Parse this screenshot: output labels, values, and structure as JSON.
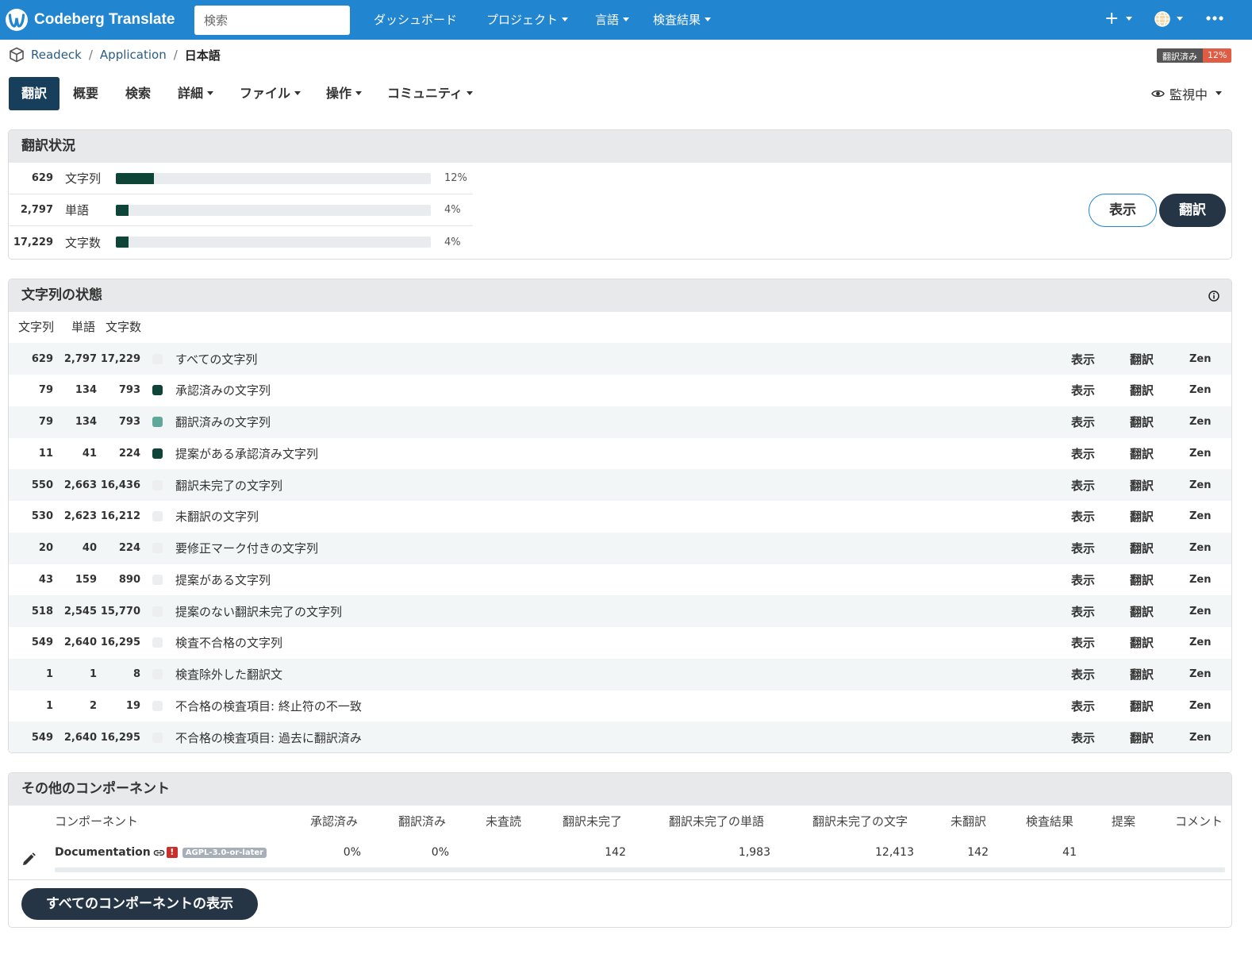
{
  "brand": {
    "name": "Codeberg Translate",
    "color": "#2185d0"
  },
  "search": {
    "placeholder": "検索"
  },
  "nav": {
    "dashboard": "ダッシュボード",
    "projects": "プロジェクト",
    "languages": "言語",
    "checks": "検査結果",
    "add": "+"
  },
  "breadcrumb": {
    "project": "Readeck",
    "component": "Application",
    "language": "日本語",
    "badge_label": "翻訳済み",
    "badge_value": "12%"
  },
  "tabs": {
    "translate": "翻訳",
    "overview": "概要",
    "search": "検索",
    "details": "詳細",
    "files": "ファイル",
    "operations": "操作",
    "community": "コミュニティ",
    "watch": "監視中"
  },
  "status": {
    "title": "翻訳状況",
    "rows": [
      {
        "count": "629",
        "label": "文字列",
        "percent": "12%",
        "fill": 0.12
      },
      {
        "count": "2,797",
        "label": "単語",
        "percent": "4%",
        "fill": 0.04
      },
      {
        "count": "17,229",
        "label": "文字数",
        "percent": "4%",
        "fill": 0.04
      }
    ],
    "browse_label": "表示",
    "translate_label": "翻訳"
  },
  "states": {
    "title": "文字列の状態",
    "headers": {
      "strings": "文字列",
      "words": "単語",
      "chars": "文字数"
    },
    "actions": {
      "browse": "表示",
      "translate": "翻訳",
      "zen": "Zen"
    },
    "colors": {
      "approved": "#0f4438",
      "translated": "#5fa89a",
      "empty": "#eceef0"
    },
    "rows": [
      {
        "strings": "629",
        "words": "2,797",
        "chars": "17,229",
        "label": "すべての文字列",
        "marker": "empty"
      },
      {
        "strings": "79",
        "words": "134",
        "chars": "793",
        "label": "承認済みの文字列",
        "marker": "approved"
      },
      {
        "strings": "79",
        "words": "134",
        "chars": "793",
        "label": "翻訳済みの文字列",
        "marker": "translated"
      },
      {
        "strings": "11",
        "words": "41",
        "chars": "224",
        "label": "提案がある承認済み文字列",
        "marker": "approved"
      },
      {
        "strings": "550",
        "words": "2,663",
        "chars": "16,436",
        "label": "翻訳未完了の文字列",
        "marker": "empty"
      },
      {
        "strings": "530",
        "words": "2,623",
        "chars": "16,212",
        "label": "未翻訳の文字列",
        "marker": "empty"
      },
      {
        "strings": "20",
        "words": "40",
        "chars": "224",
        "label": "要修正マーク付きの文字列",
        "marker": "empty"
      },
      {
        "strings": "43",
        "words": "159",
        "chars": "890",
        "label": "提案がある文字列",
        "marker": "empty"
      },
      {
        "strings": "518",
        "words": "2,545",
        "chars": "15,770",
        "label": "提案のない翻訳未完了の文字列",
        "marker": "empty"
      },
      {
        "strings": "549",
        "words": "2,640",
        "chars": "16,295",
        "label": "検査不合格の文字列",
        "marker": "empty"
      },
      {
        "strings": "1",
        "words": "1",
        "chars": "8",
        "label": "検査除外した翻訳文",
        "marker": "empty"
      },
      {
        "strings": "1",
        "words": "2",
        "chars": "19",
        "label": "不合格の検査項目: 終止符の不一致",
        "marker": "empty"
      },
      {
        "strings": "549",
        "words": "2,640",
        "chars": "16,295",
        "label": "不合格の検査項目: 過去に翻訳済み",
        "marker": "empty"
      }
    ]
  },
  "components": {
    "title": "その他のコンポーネント",
    "headers": {
      "component": "コンポーネント",
      "approved": "承認済み",
      "translated": "翻訳済み",
      "unreviewed": "未査読",
      "unfinished": "翻訳未完了",
      "unfinished_words": "翻訳未完了の単語",
      "unfinished_chars": "翻訳未完了の文字",
      "untranslated": "未翻訳",
      "checks": "検査結果",
      "suggestions": "提案",
      "comments": "コメント"
    },
    "row": {
      "name": "Documentation",
      "alert": "!",
      "license": "AGPL-3.0-or-later",
      "approved": "0%",
      "translated": "0%",
      "unreviewed": "",
      "unfinished": "142",
      "unfinished_words": "1,983",
      "unfinished_chars": "12,413",
      "untranslated": "142",
      "checks": "41",
      "suggestions": "",
      "comments": ""
    },
    "show_all_label": "すべてのコンポーネントの表示"
  }
}
